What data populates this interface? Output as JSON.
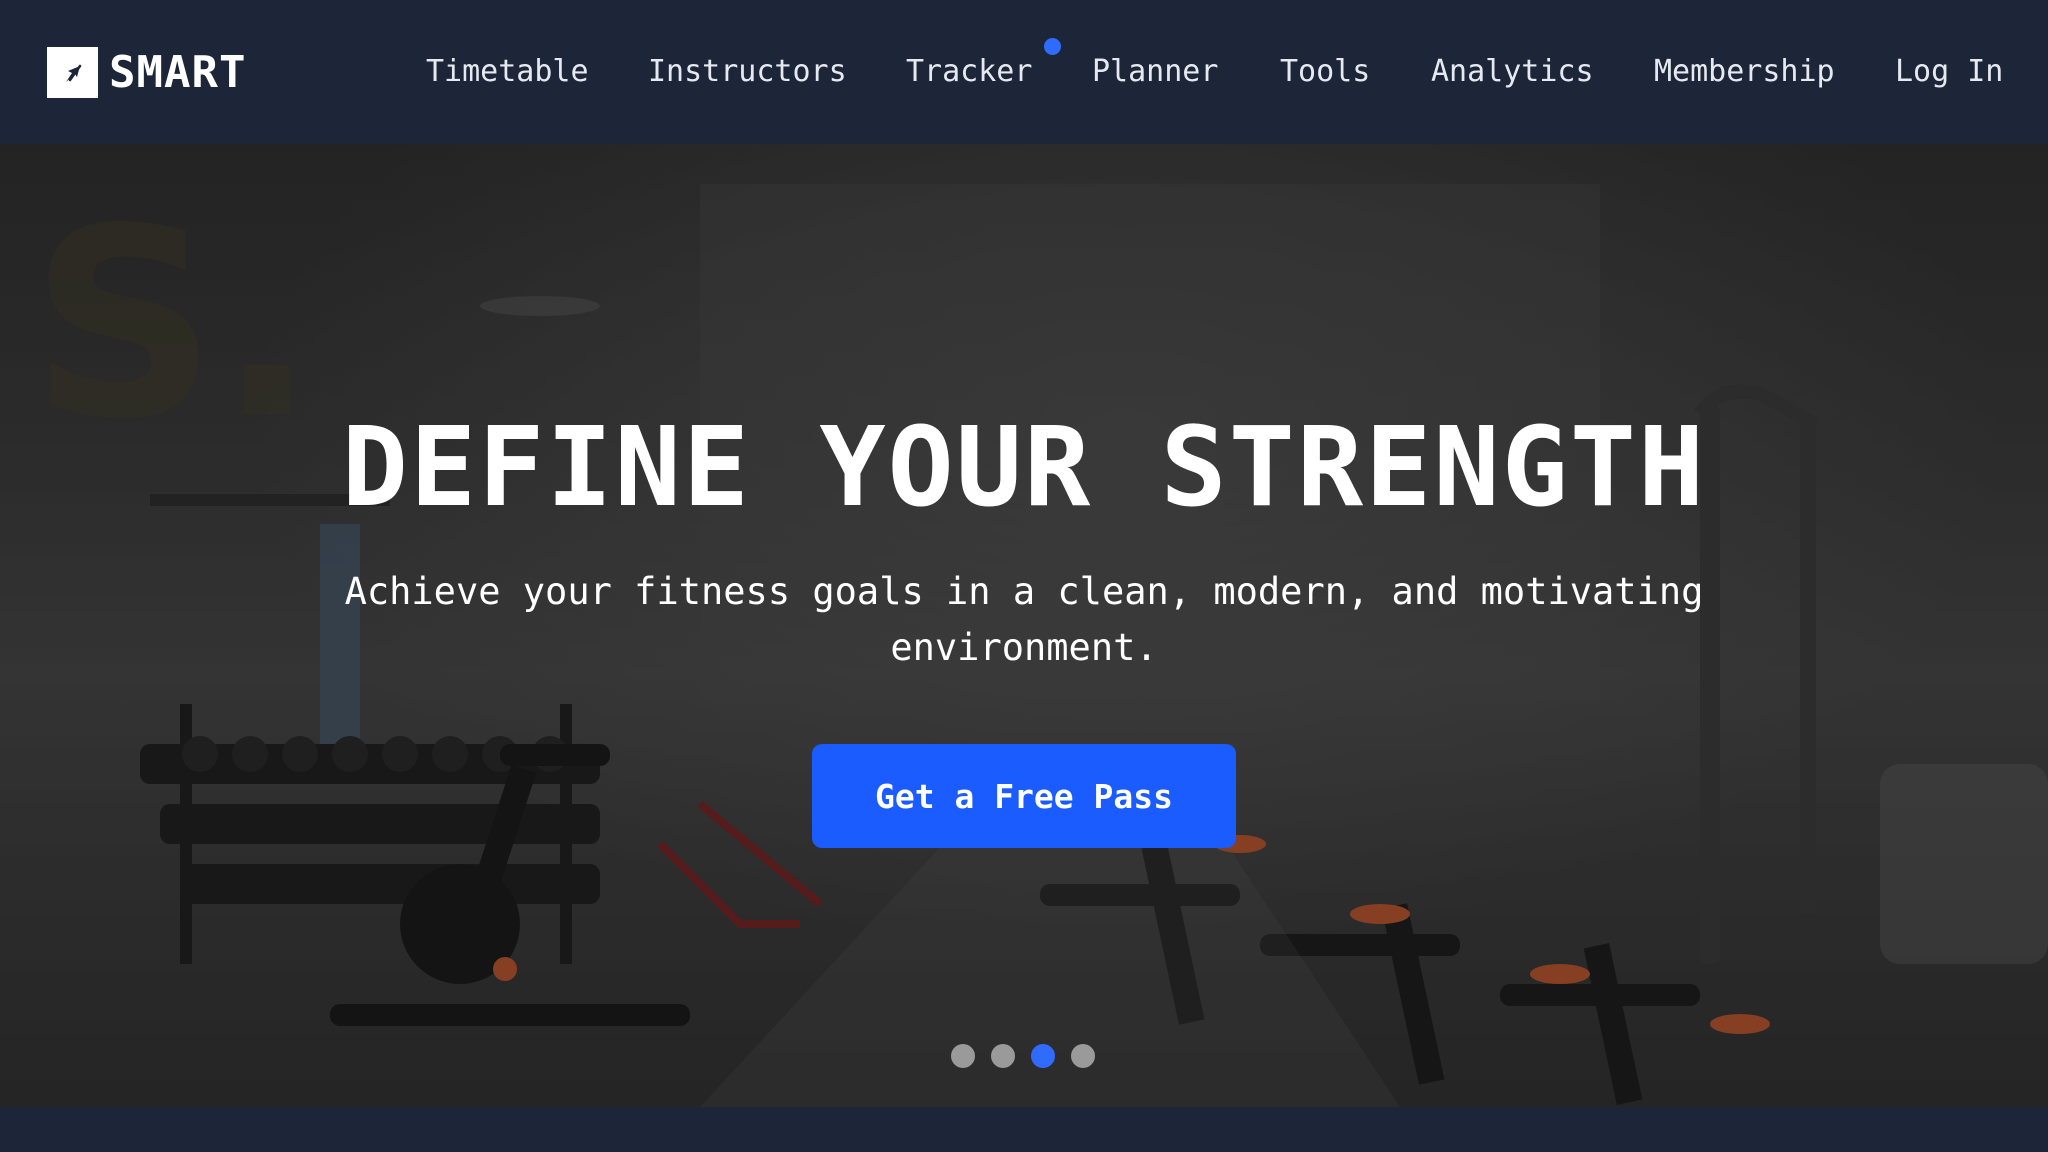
{
  "brand": {
    "name": "SMART",
    "logo_icon": "compass-arrow-icon"
  },
  "nav": {
    "items": [
      {
        "label": "Timetable"
      },
      {
        "label": "Instructors"
      },
      {
        "label": "Tracker",
        "has_notification": true
      },
      {
        "label": "Planner"
      },
      {
        "label": "Tools"
      },
      {
        "label": "Analytics"
      },
      {
        "label": "Membership"
      },
      {
        "label": "Log In"
      }
    ]
  },
  "hero": {
    "title": "DEFINE YOUR STRENGTH",
    "subtitle": "Achieve your fitness goals in a clean, modern, and motivating environment.",
    "cta_label": "Get a Free Pass",
    "slides_total": 4,
    "active_slide": 3
  },
  "colors": {
    "nav_bg": "#1c2638",
    "accent": "#1a5cff",
    "notification": "#2f6bff"
  }
}
